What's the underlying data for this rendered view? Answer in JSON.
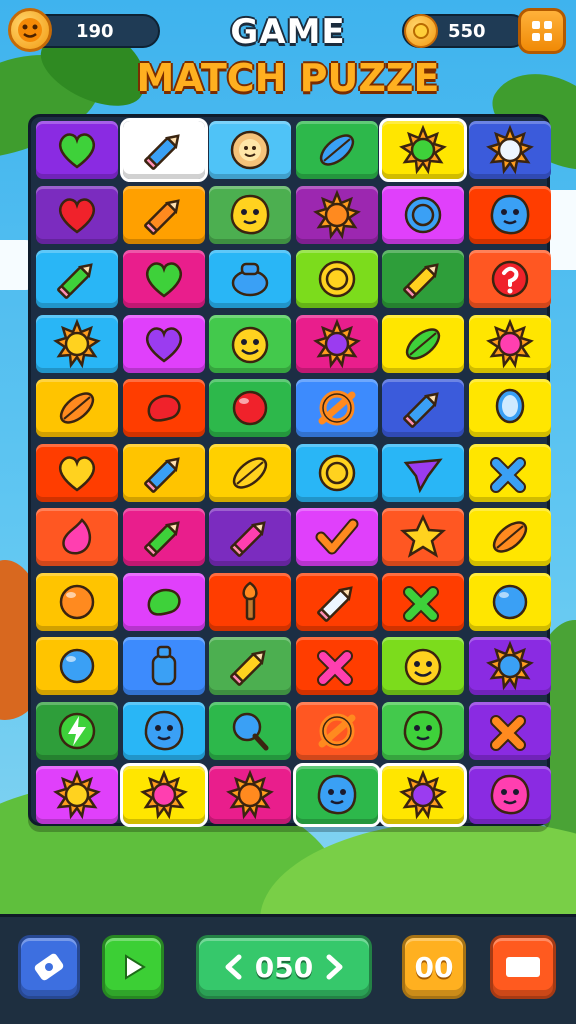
{
  "hud": {
    "moves": "190",
    "coins": "550"
  },
  "title": {
    "line1": "GAME",
    "line2": "MATCH PUZZE"
  },
  "board": {
    "columns": 6,
    "rows": 11,
    "tiles": [
      [
        {
          "bg": "#8a2be2",
          "icon": "heart-green"
        },
        {
          "bg": "#ffffff",
          "icon": "pencil-blue",
          "sel": true
        },
        {
          "bg": "#4fc3f7",
          "icon": "gear-face"
        },
        {
          "bg": "#2db84b",
          "icon": "leaf-blue"
        },
        {
          "bg": "#ffe600",
          "icon": "sun-green",
          "sel": true
        },
        {
          "bg": "#3b5bdb",
          "icon": "sun-white"
        }
      ],
      [
        {
          "bg": "#7b2cbf",
          "icon": "heart-red"
        },
        {
          "bg": "#ffa000",
          "icon": "pencil-orange"
        },
        {
          "bg": "#4caf50",
          "icon": "blob-yellow"
        },
        {
          "bg": "#9c27b0",
          "icon": "sun-orange"
        },
        {
          "bg": "#e040fb",
          "icon": "coin-blue"
        },
        {
          "bg": "#ff3d00",
          "icon": "blob-blue"
        }
      ],
      [
        {
          "bg": "#29b6f6",
          "icon": "pencil-green"
        },
        {
          "bg": "#e91e8c",
          "icon": "heart-green"
        },
        {
          "bg": "#29b6f6",
          "icon": "pot-blue"
        },
        {
          "bg": "#7cdc1c",
          "icon": "coin-yellow"
        },
        {
          "bg": "#2e9e3a",
          "icon": "pencil-yellow"
        },
        {
          "bg": "#ff5722",
          "icon": "question-red"
        }
      ],
      [
        {
          "bg": "#29b6f6",
          "icon": "sun-yellow"
        },
        {
          "bg": "#e040fb",
          "icon": "heart-purple"
        },
        {
          "bg": "#43c94c",
          "icon": "face-yellow"
        },
        {
          "bg": "#e91e8c",
          "icon": "sun-purple"
        },
        {
          "bg": "#ffe600",
          "icon": "leaf-green"
        },
        {
          "bg": "#ffe600",
          "icon": "sun-pink"
        }
      ],
      [
        {
          "bg": "#ffc400",
          "icon": "leaf-orange"
        },
        {
          "bg": "#ff3d00",
          "icon": "bean-red"
        },
        {
          "bg": "#2db84b",
          "icon": "ball-red"
        },
        {
          "bg": "#3d8bfd",
          "icon": "knot-orange"
        },
        {
          "bg": "#3b5bdb",
          "icon": "pencil-blue"
        },
        {
          "bg": "#ffe600",
          "icon": "mirror-blue"
        }
      ],
      [
        {
          "bg": "#ff3d00",
          "icon": "heart-yellow"
        },
        {
          "bg": "#ffc400",
          "icon": "pencil-blue"
        },
        {
          "bg": "#ffd000",
          "icon": "leaf-yellow"
        },
        {
          "bg": "#29b6f6",
          "icon": "coin-yellow"
        },
        {
          "bg": "#29b6f6",
          "icon": "spinner-purple"
        },
        {
          "bg": "#ffe600",
          "icon": "cross-blue"
        }
      ],
      [
        {
          "bg": "#ff5722",
          "icon": "drop-pink"
        },
        {
          "bg": "#e91e8c",
          "icon": "pencil-green"
        },
        {
          "bg": "#7b2cbf",
          "icon": "pencil-pink"
        },
        {
          "bg": "#e040fb",
          "icon": "check-orange"
        },
        {
          "bg": "#ff5722",
          "icon": "star-yellow"
        },
        {
          "bg": "#ffe600",
          "icon": "leaf-orange"
        }
      ],
      [
        {
          "bg": "#ffc400",
          "icon": "ball-orange"
        },
        {
          "bg": "#e040fb",
          "icon": "bean-green"
        },
        {
          "bg": "#ff3d00",
          "icon": "torch-orange"
        },
        {
          "bg": "#ff3d00",
          "icon": "pencil-white"
        },
        {
          "bg": "#ff3d00",
          "icon": "cross-green"
        },
        {
          "bg": "#ffe600",
          "icon": "ball-blue"
        }
      ],
      [
        {
          "bg": "#ffc400",
          "icon": "ball-blue"
        },
        {
          "bg": "#3d8bfd",
          "icon": "bottle-blue"
        },
        {
          "bg": "#4caf50",
          "icon": "pencil-yellow"
        },
        {
          "bg": "#ff3d00",
          "icon": "cross-pink"
        },
        {
          "bg": "#7cdc1c",
          "icon": "face-yellow"
        },
        {
          "bg": "#8a2be2",
          "icon": "sun-blue"
        }
      ],
      [
        {
          "bg": "#2e9e3a",
          "icon": "bolt-green"
        },
        {
          "bg": "#29b6f6",
          "icon": "blob-blue"
        },
        {
          "bg": "#2db84b",
          "icon": "lolly-blue"
        },
        {
          "bg": "#ff5722",
          "icon": "knot-orange"
        },
        {
          "bg": "#43c94c",
          "icon": "blob-green"
        },
        {
          "bg": "#8a2be2",
          "icon": "cross-orange"
        }
      ],
      [
        {
          "bg": "#e040fb",
          "icon": "sun-yellow"
        },
        {
          "bg": "#ffe600",
          "icon": "sun-pink",
          "sel": true
        },
        {
          "bg": "#e91e8c",
          "icon": "sun-orange"
        },
        {
          "bg": "#2db84b",
          "icon": "blob-blue",
          "sel": true
        },
        {
          "bg": "#ffe600",
          "icon": "sun-purple",
          "sel": true
        },
        {
          "bg": "#8a2be2",
          "icon": "blob-pink"
        }
      ]
    ]
  },
  "bottom_bar": {
    "level_value": "050",
    "timer_value": "00"
  },
  "colors": {
    "accent": "#ffb020",
    "board_bg": "#1c2e44",
    "play_green": "#3ccf35"
  }
}
